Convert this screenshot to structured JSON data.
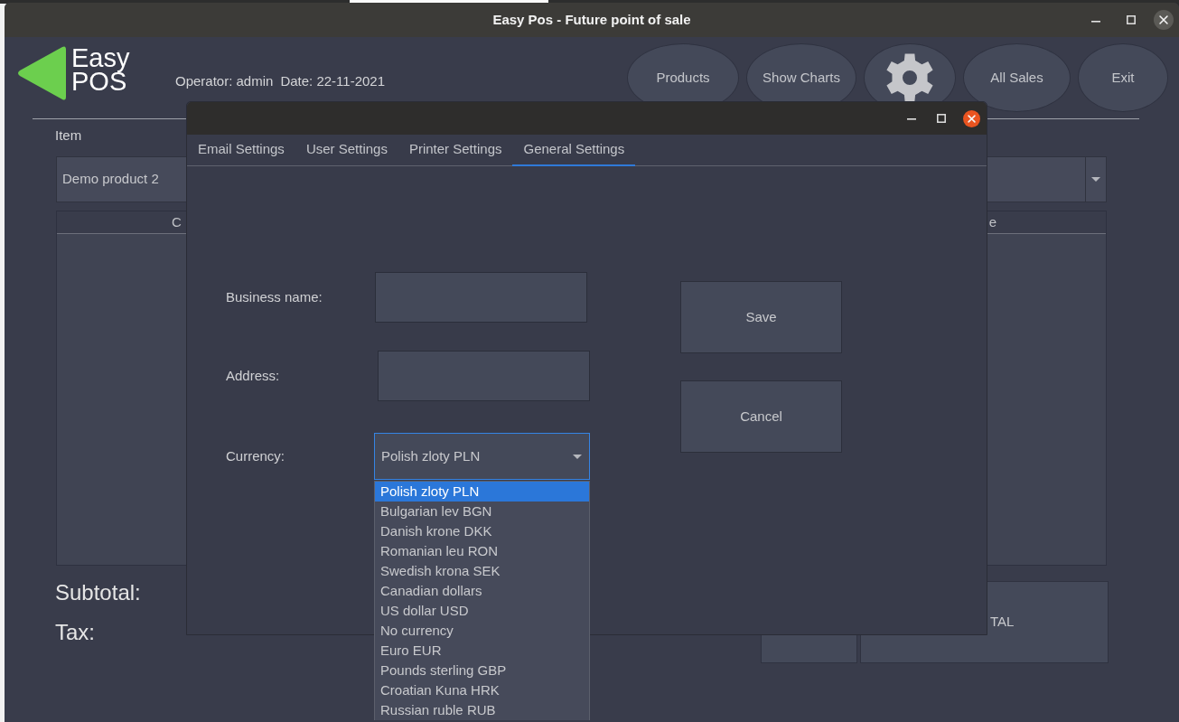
{
  "window": {
    "title": "Easy Pos - Future point of sale"
  },
  "header": {
    "logo": [
      "Easy",
      "POS"
    ],
    "operator": "Operator: admin",
    "date": "Date: 22-11-2021",
    "buttons": [
      {
        "kind": "text",
        "label": "Products"
      },
      {
        "kind": "text",
        "label": "Show Charts"
      },
      {
        "kind": "icon"
      },
      {
        "kind": "text",
        "label": "All Sales"
      },
      {
        "kind": "text",
        "label": "Exit"
      }
    ]
  },
  "item": {
    "label": "Item",
    "value": "Demo product 2"
  },
  "table": {
    "column_1": "C",
    "column_4": "e"
  },
  "totals": {
    "subtotal_label": "Subtotal:",
    "tax_label": "Tax:"
  },
  "bottom_buttons": [
    {
      "kind": "blank"
    },
    {
      "kind": "text",
      "label": "TAL"
    }
  ],
  "dialog": {
    "tabs": [
      {
        "label": "Email Settings",
        "selected": false
      },
      {
        "label": "User Settings",
        "selected": false
      },
      {
        "label": "Printer Settings",
        "selected": false
      },
      {
        "label": "General Settings",
        "selected": true
      }
    ],
    "fields": [
      {
        "kind": "text",
        "label": "Business name:"
      },
      {
        "kind": "text",
        "label": "Address:"
      },
      {
        "kind": "select",
        "label": "Currency:",
        "value": "Polish zloty PLN",
        "expanded": true,
        "options": [
          {
            "label": "Polish zloty PLN",
            "selected": true
          },
          {
            "label": "Bulgarian lev BGN",
            "selected": false
          },
          {
            "label": "Danish krone DKK",
            "selected": false
          },
          {
            "label": "Romanian leu RON",
            "selected": false
          },
          {
            "label": "Swedish krona SEK",
            "selected": false
          },
          {
            "label": "Canadian dollars",
            "selected": false
          },
          {
            "label": "US dollar USD",
            "selected": false
          },
          {
            "label": "No currency",
            "selected": false
          },
          {
            "label": "Euro EUR",
            "selected": false
          },
          {
            "label": "Pounds sterling GBP",
            "selected": false
          },
          {
            "label": "Croatian Kuna HRK",
            "selected": false
          },
          {
            "label": "Russian ruble RUB",
            "selected": false
          }
        ]
      }
    ],
    "buttons": [
      "Save",
      "Cancel"
    ]
  }
}
